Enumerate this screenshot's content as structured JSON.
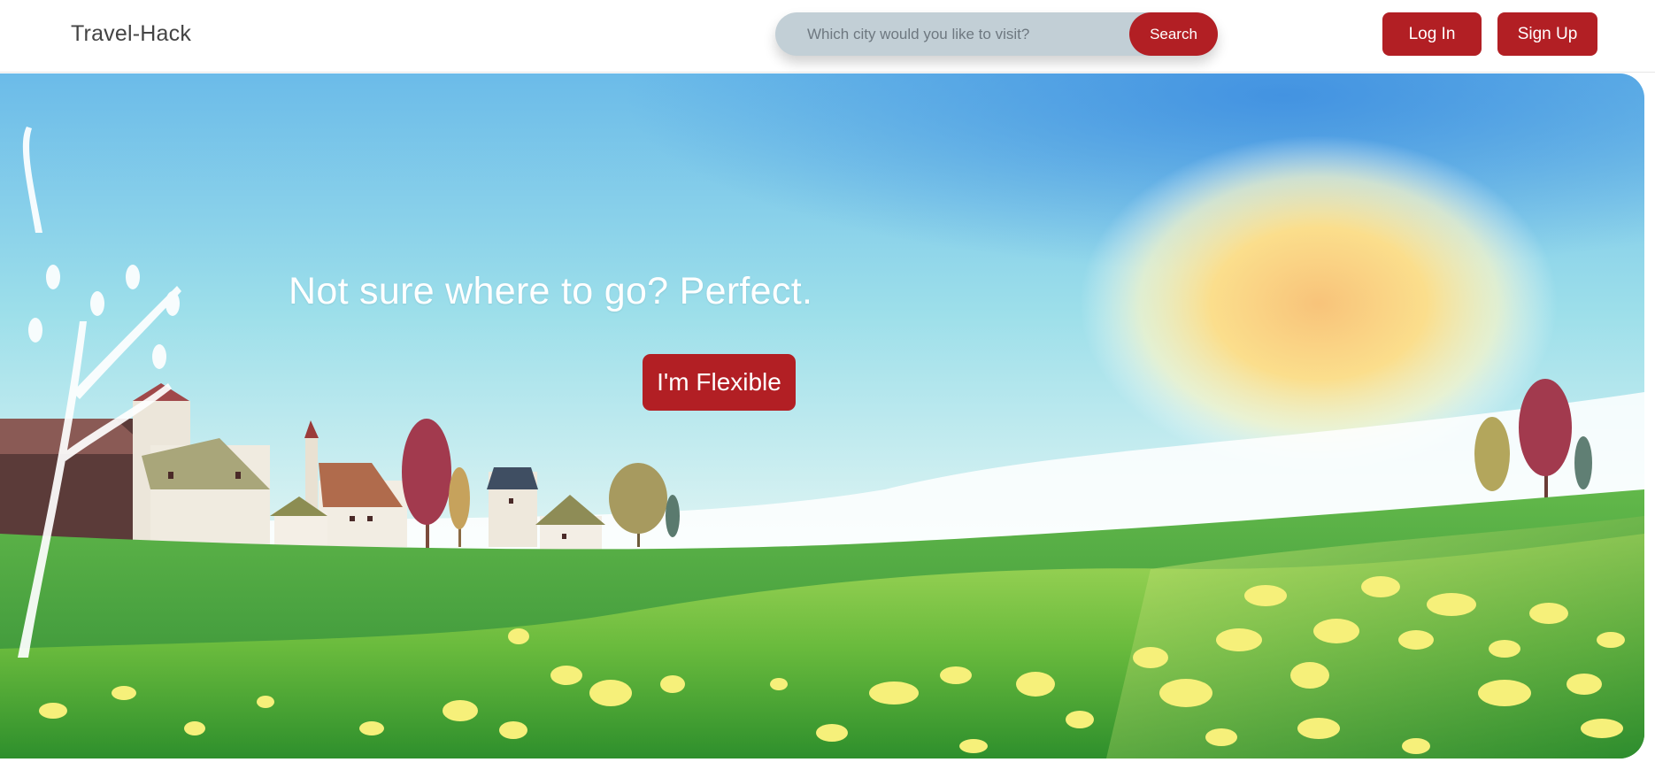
{
  "header": {
    "brand": "Travel-Hack",
    "search": {
      "placeholder": "Which city would you like to visit?",
      "button_label": "Search"
    },
    "login_label": "Log In",
    "signup_label": "Sign Up"
  },
  "hero": {
    "title": "Not sure where to go? Perfect.",
    "cta_label": "I'm Flexible",
    "illustration": "spring-countryside-village-sun-illustration"
  },
  "colors": {
    "accent": "#b21f24",
    "search_bg": "#c2cfd6",
    "sky": "#86d3e8",
    "grass": "#4aa33a"
  }
}
